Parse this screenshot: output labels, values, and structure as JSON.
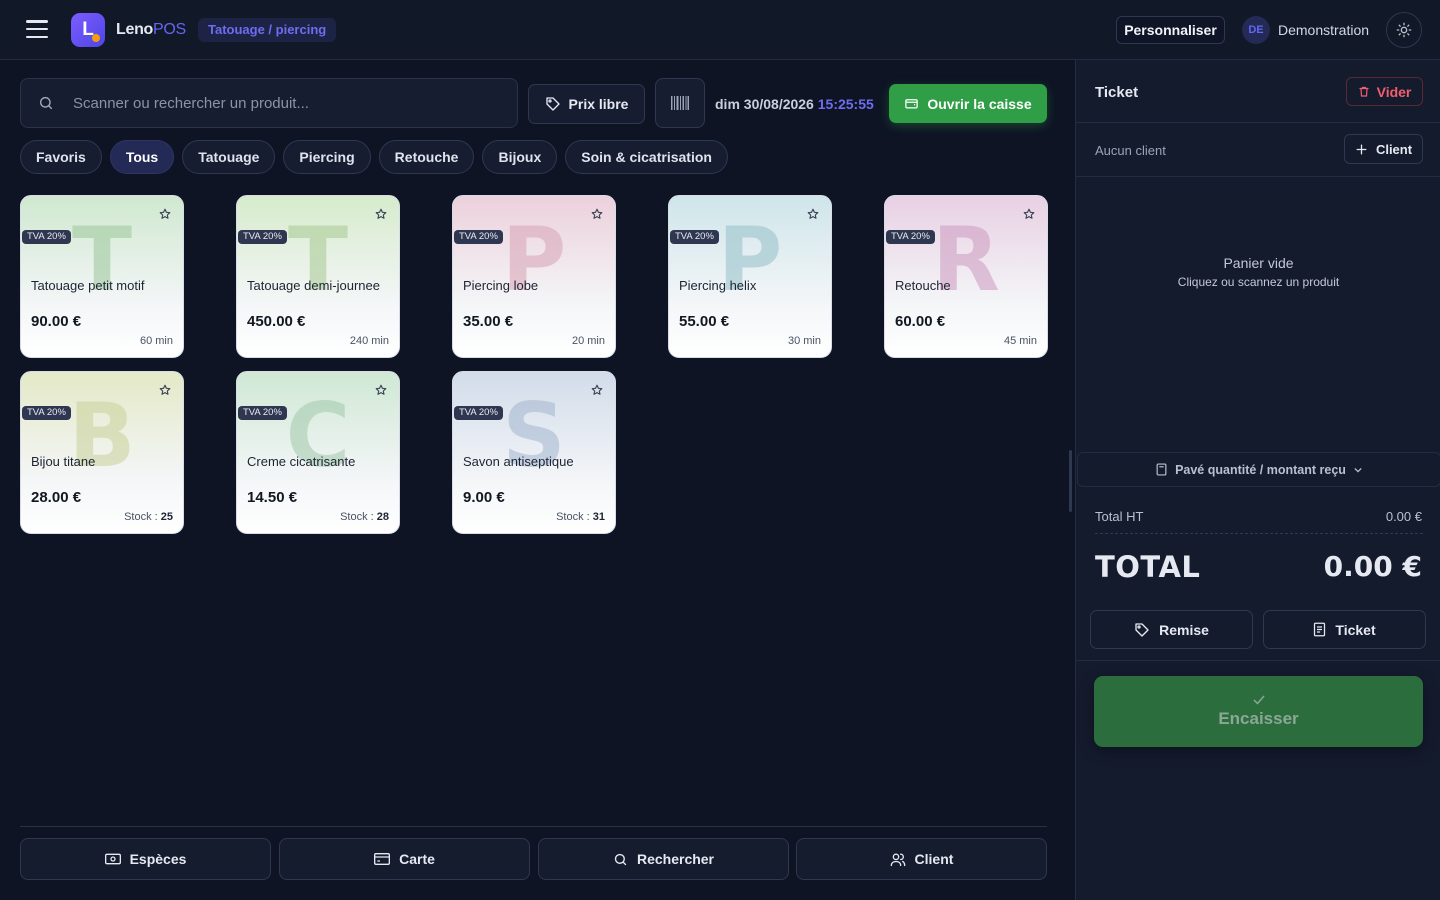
{
  "header": {
    "brand_main": "Leno",
    "brand_accent": "POS",
    "sector": "Tatouage / piercing",
    "personalize_label": "Personnaliser",
    "user_initials": "DE",
    "user_name": "Demonstration"
  },
  "toolbar": {
    "search_placeholder": "Scanner ou rechercher un produit...",
    "prix_libre_label": "Prix libre",
    "date": "dim 30/08/2026",
    "time": "15:25:55",
    "open_register_label": "Ouvrir la caisse"
  },
  "categories": [
    {
      "label": "Favoris",
      "active": false
    },
    {
      "label": "Tous",
      "active": true
    },
    {
      "label": "Tatouage",
      "active": false
    },
    {
      "label": "Piercing",
      "active": false
    },
    {
      "label": "Retouche",
      "active": false
    },
    {
      "label": "Bijoux",
      "active": false
    },
    {
      "label": "Soin & cicatrisation",
      "active": false
    }
  ],
  "products": [
    {
      "letter": "T",
      "tva": "TVA 20%",
      "name": "Tatouage petit motif",
      "price": "90.00 €",
      "meta_label": "",
      "meta_value": "60 min",
      "color": "#cfe8cf",
      "letter_color": "#9cc69a"
    },
    {
      "letter": "T",
      "tva": "TVA 20%",
      "name": "Tatouage demi-journee",
      "price": "450.00 €",
      "meta_label": "",
      "meta_value": "240 min",
      "color": "#d6ebcc",
      "letter_color": "#a7c993"
    },
    {
      "letter": "P",
      "tva": "TVA 20%",
      "name": "Piercing lobe",
      "price": "35.00 €",
      "meta_label": "",
      "meta_value": "20 min",
      "color": "#ecd0db",
      "letter_color": "#d7a2b4"
    },
    {
      "letter": "P",
      "tva": "TVA 20%",
      "name": "Piercing helix",
      "price": "55.00 €",
      "meta_label": "",
      "meta_value": "30 min",
      "color": "#cfe5ea",
      "letter_color": "#95c0c9"
    },
    {
      "letter": "R",
      "tva": "TVA 20%",
      "name": "Retouche",
      "price": "60.00 €",
      "meta_label": "",
      "meta_value": "45 min",
      "color": "#e8d0e3",
      "letter_color": "#cc9ac0"
    },
    {
      "letter": "B",
      "tva": "TVA 20%",
      "name": "Bijou titane",
      "price": "28.00 €",
      "meta_label": "Stock : ",
      "meta_value": "25",
      "color": "#e4e9c7",
      "letter_color": "#c9d19a"
    },
    {
      "letter": "C",
      "tva": "TVA 20%",
      "name": "Creme cicatrisante",
      "price": "14.50 €",
      "meta_label": "Stock : ",
      "meta_value": "28",
      "color": "#cfe8d4",
      "letter_color": "#a2c9ac"
    },
    {
      "letter": "S",
      "tva": "TVA 20%",
      "name": "Savon antiseptique",
      "price": "9.00 €",
      "meta_label": "Stock : ",
      "meta_value": "31",
      "color": "#d2dcea",
      "letter_color": "#a3b6cf"
    }
  ],
  "payment_buttons": [
    {
      "label": "Espèces",
      "icon": "banknote-icon"
    },
    {
      "label": "Carte",
      "icon": "credit-card-icon"
    },
    {
      "label": "Rechercher",
      "icon": "search-icon"
    },
    {
      "label": "Client",
      "icon": "users-icon"
    }
  ],
  "ticket": {
    "title": "Ticket",
    "clear_label": "Vider",
    "no_client": "Aucun client",
    "client_label": "Client",
    "empty_title": "Panier vide",
    "empty_hint": "Cliquez ou scannez un produit",
    "keypad_label": "Pavé quantité / montant reçu",
    "total_ht_label": "Total HT",
    "total_ht_value": "0.00 €",
    "total_label": "TOTAL",
    "total_value": "0.00 €",
    "discount_label": "Remise",
    "ticket_label": "Ticket",
    "checkout_label": "Encaisser"
  },
  "colors": {
    "accent": "#6366f1",
    "success": "#2f9e46",
    "danger": "#f25d6f",
    "background": "#0e1424"
  }
}
